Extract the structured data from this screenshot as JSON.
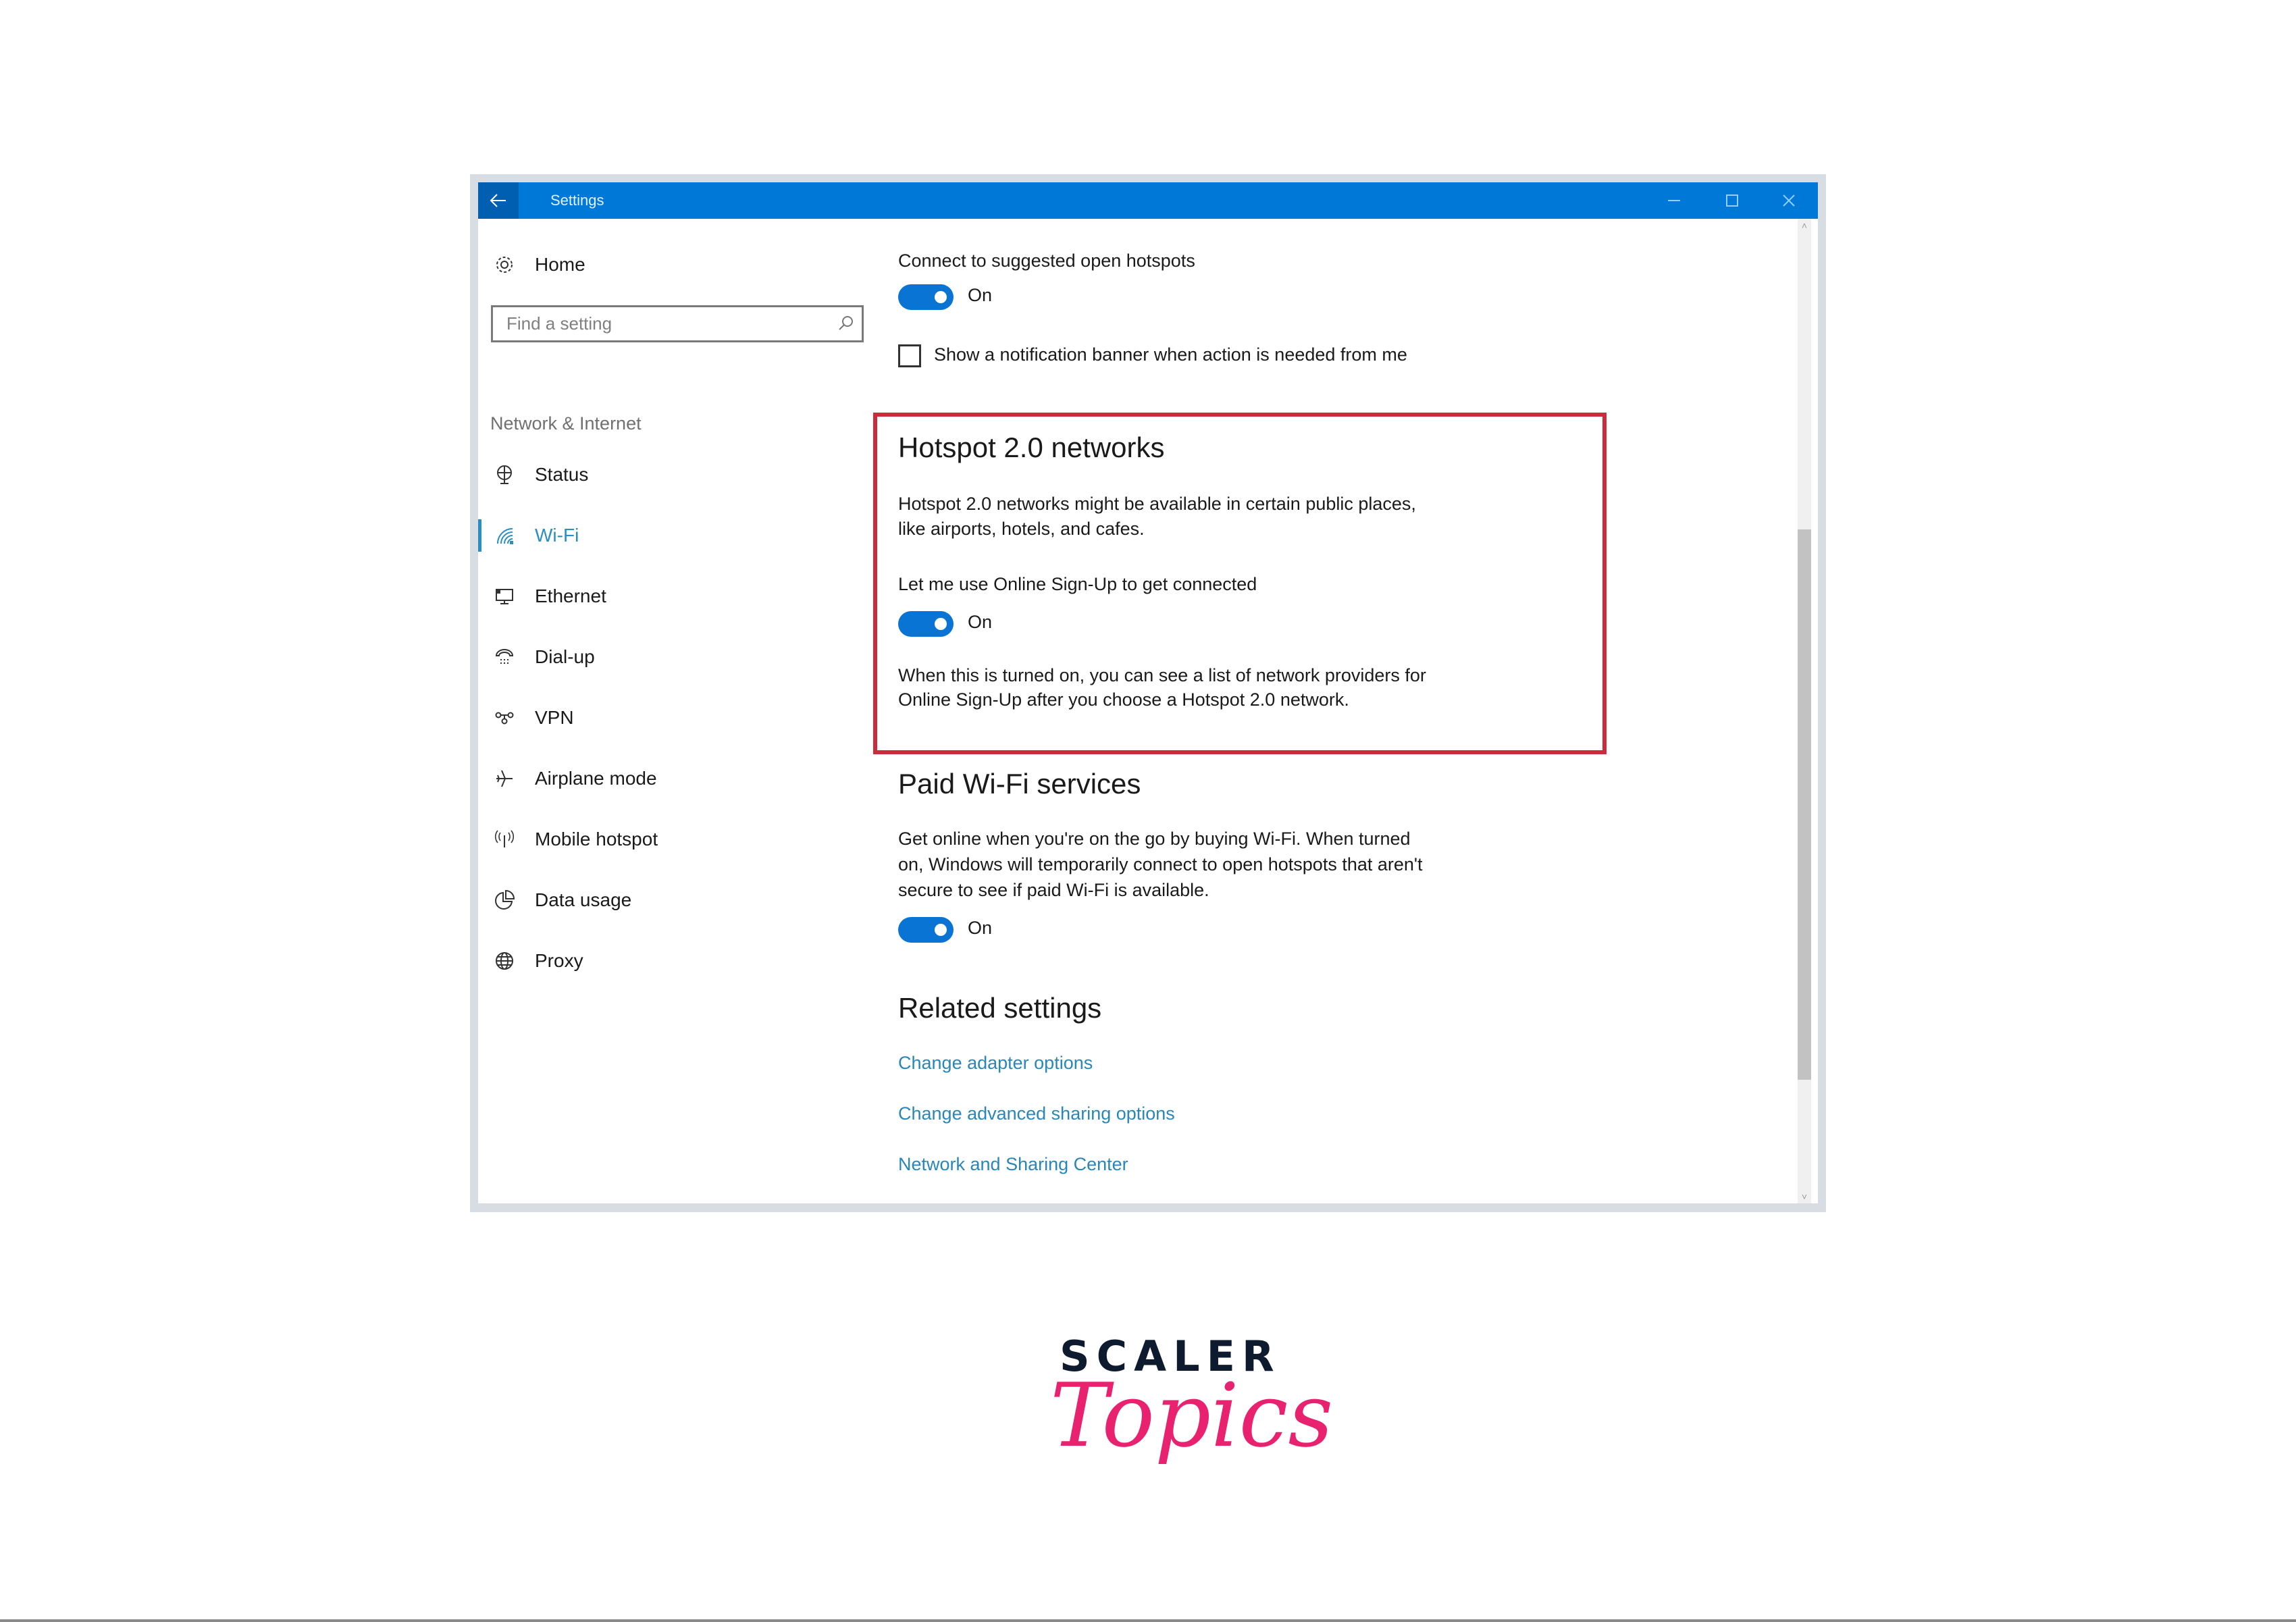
{
  "window": {
    "title": "Settings",
    "icons": {
      "back": "back-arrow-icon",
      "minimize": "minimize-icon",
      "maximize": "maximize-icon",
      "close": "close-icon"
    }
  },
  "sidebar": {
    "home_label": "Home",
    "search_placeholder": "Find a setting",
    "section_label": "Network & Internet",
    "items": [
      {
        "label": "Status",
        "icon": "globe-monitor-icon",
        "active": false
      },
      {
        "label": "Wi-Fi",
        "icon": "wifi-icon",
        "active": true
      },
      {
        "label": "Ethernet",
        "icon": "ethernet-icon",
        "active": false
      },
      {
        "label": "Dial-up",
        "icon": "dial-up-phone-icon",
        "active": false
      },
      {
        "label": "VPN",
        "icon": "vpn-icon",
        "active": false
      },
      {
        "label": "Airplane mode",
        "icon": "airplane-icon",
        "active": false
      },
      {
        "label": "Mobile hotspot",
        "icon": "mobile-hotspot-icon",
        "active": false
      },
      {
        "label": "Data usage",
        "icon": "data-usage-pie-icon",
        "active": false
      },
      {
        "label": "Proxy",
        "icon": "globe-icon",
        "active": false
      }
    ]
  },
  "content": {
    "suggested": {
      "label": "Connect to suggested open hotspots",
      "toggle_state": "On",
      "checkbox_label": "Show a notification banner when action is needed from me",
      "checkbox_checked": false
    },
    "hotspot20": {
      "heading": "Hotspot 2.0 networks",
      "desc_line1": "Hotspot 2.0 networks might be available in certain public places,",
      "desc_line2": "like airports, hotels, and cafes.",
      "option_label": "Let me use Online Sign-Up to get connected",
      "toggle_state": "On",
      "note_line1": "When this is turned on, you can see a list of network providers for",
      "note_line2": "Online Sign-Up after you choose a Hotspot 2.0 network."
    },
    "paid_wifi": {
      "heading": "Paid Wi-Fi services",
      "desc_line1": "Get online when you're on the go by buying Wi-Fi. When turned",
      "desc_line2": "on, Windows will temporarily connect to open hotspots that aren't",
      "desc_line3": "secure to see if paid Wi-Fi is available.",
      "toggle_state": "On"
    },
    "related": {
      "heading": "Related settings",
      "links": [
        "Change adapter options",
        "Change advanced sharing options",
        "Network and Sharing Center"
      ]
    }
  },
  "colors": {
    "titlebar": "#0078d7",
    "accent": "#0a74d4",
    "link": "#2a86b8",
    "highlight_border": "#cc2b3b",
    "logo_dark": "#0e1a2e",
    "logo_pink": "#e8226f"
  },
  "branding": {
    "line1": "SCALER",
    "line2": "Topics"
  }
}
